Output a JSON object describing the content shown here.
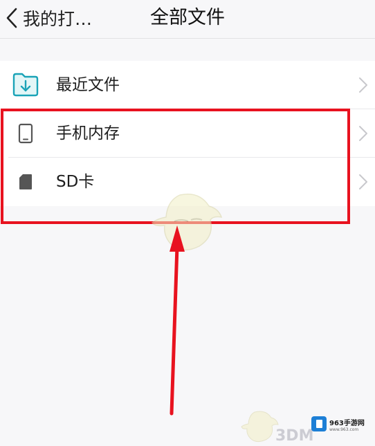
{
  "header": {
    "back_label": "我的打…",
    "title": "全部文件"
  },
  "list": {
    "items": [
      {
        "label": "最近文件",
        "icon": "folder-download-icon"
      },
      {
        "label": "手机内存",
        "icon": "phone-icon"
      },
      {
        "label": "SD卡",
        "icon": "sd-card-icon"
      }
    ]
  },
  "colors": {
    "accent_icon": "#1aa3b7",
    "highlight": "#e8121f"
  },
  "watermark": {
    "brand": "963手游网",
    "site": "www.963.com",
    "logo": "3DM"
  }
}
